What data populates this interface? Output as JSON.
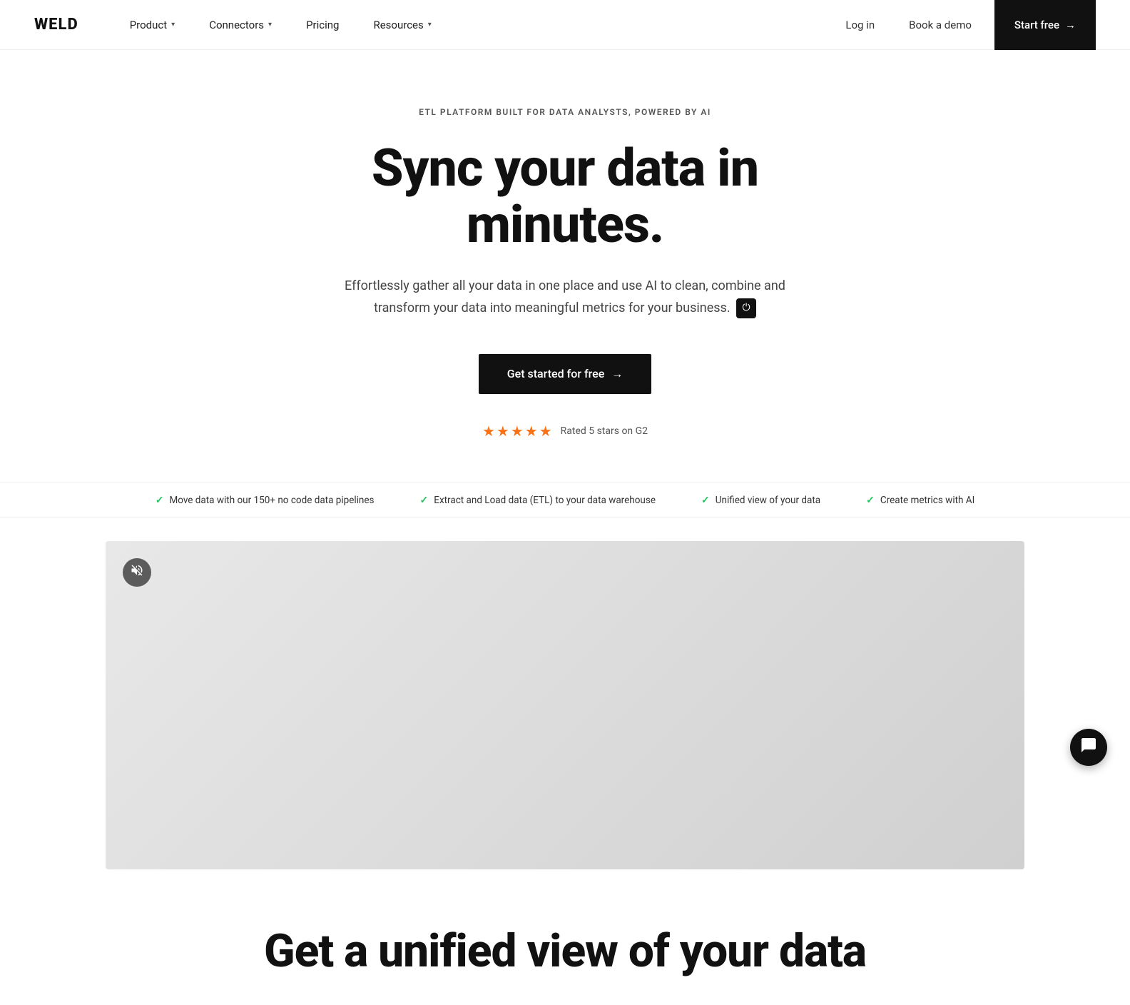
{
  "brand": {
    "logo": "WELD"
  },
  "navbar": {
    "items": [
      {
        "label": "Product",
        "hasDropdown": true
      },
      {
        "label": "Connectors",
        "hasDropdown": true
      },
      {
        "label": "Pricing",
        "hasDropdown": false
      },
      {
        "label": "Resources",
        "hasDropdown": true
      }
    ],
    "login_label": "Log in",
    "book_demo_label": "Book a demo",
    "start_free_label": "Start free",
    "arrow": "→"
  },
  "hero": {
    "eyebrow": "ETL PLATFORM BUILT FOR DATA ANALYSTS, POWERED BY AI",
    "title": "Sync your data in minutes.",
    "description_part1": "Effortlessly gather all your data in one place and use AI to clean, combine and transform your data into meaningful metrics for your business.",
    "weld_icon_label": "⏻",
    "cta_label": "Get started for free",
    "cta_arrow": "→",
    "rating_label": "Rated 5 stars on G2",
    "stars": [
      "★",
      "★",
      "★",
      "★",
      "★"
    ]
  },
  "features": [
    {
      "text": "Move data with our 150+ no code data pipelines"
    },
    {
      "text": "Extract and Load data (ETL) to your data warehouse"
    },
    {
      "text": "Unified view of your data"
    },
    {
      "text": "Create metrics with AI"
    }
  ],
  "video": {
    "mute_icon": "🔇"
  },
  "unified_section": {
    "title": "Get a unified view of your data"
  },
  "chat_widget": {
    "icon": "💬"
  },
  "colors": {
    "star_color": "#f97316",
    "check_color": "#22c55e",
    "brand_black": "#111111",
    "text_gray": "#555555"
  }
}
